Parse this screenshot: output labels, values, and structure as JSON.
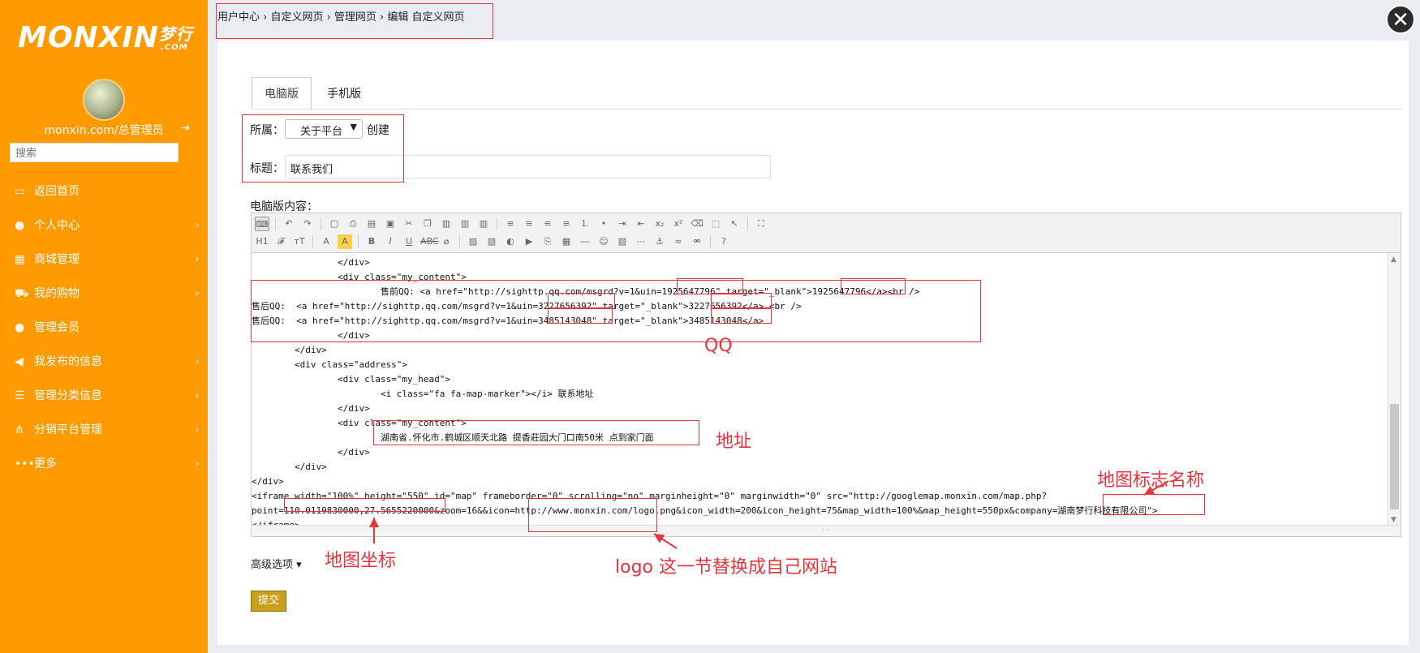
{
  "sidebar": {
    "logo": "MONXIN",
    "logo_cn": "梦行",
    "logo_com": ".COM",
    "user": "monxin.com/总管理员",
    "logout_icon": "logout-icon",
    "search_placeholder": "搜索",
    "items": [
      {
        "label": "返回首页",
        "icon": "monitor-icon"
      },
      {
        "label": "个人中心",
        "icon": "users-icon"
      },
      {
        "label": "商城管理",
        "icon": "store-icon"
      },
      {
        "label": "我的购物",
        "icon": "cart-icon"
      },
      {
        "label": "管理会员",
        "icon": "user-icon"
      },
      {
        "label": "我发布的信息",
        "icon": "megaphone-icon"
      },
      {
        "label": "管理分类信息",
        "icon": "list-icon"
      },
      {
        "label": "分销平台管理",
        "icon": "sitemap-icon"
      },
      {
        "label": "更多",
        "icon": "more-icon"
      }
    ]
  },
  "breadcrumb": "用户中心 › 自定义网页 › 管理网页 › 编辑 自定义网页",
  "close_label": "✕",
  "tabs": [
    "电脑版",
    "手机版"
  ],
  "form": {
    "belong_label": "所属：",
    "belong_value": "关于平台",
    "create_link": "创建",
    "title_label": "标题：",
    "title_value": "联系我们",
    "content_label": "电脑版内容："
  },
  "code_lines": [
    "                </div>",
    "                <div class=\"my_content\">",
    "                        售前QQ: <a href=\"http://sighttp.qq.com/msgrd?v=1&uin=1925647796\" target=\"_blank\">1925647796</a><br />",
    "售后QQ:  <a href=\"http://sighttp.qq.com/msgrd?v=1&uin=3227656392\" target=\"_blank\">3227656392</a> <br />",
    "售后QQ:  <a href=\"http://sighttp.qq.com/msgrd?v=1&uin=3485143048\" target=\"_blank\">3485143048</a>",
    "                </div>",
    "        </div>",
    "        <div class=\"address\">",
    "                <div class=\"my_head\">",
    "                        <i class=\"fa fa-map-marker\"></i> 联系地址",
    "                </div>",
    "                <div class=\"my_content\">",
    "                        湖南省.怀化市.鹤城区顺天北路 提香莊园大门口南50米 点到家门面",
    "                </div>",
    "        </div>",
    "</div>",
    "<iframe width=\"100%\" height=\"550\" id=\"map\" frameborder=\"0\" scrolling=\"no\" marginheight=\"0\" marginwidth=\"0\" src=\"http://googlemap.monxin.com/map.php?",
    "point=110.0119830000,27.5655220000&zoom=16&&icon=http://www.monxin.com/logo.png&icon_width=200&icon_height=75&map_width=100%&map_height=550px&company=湖南梦行科技有限公司\">",
    "</iframe>"
  ],
  "annotations": {
    "qq": "QQ",
    "address": "地址",
    "map_name": "地图标志名称",
    "map_coord": "地图坐标",
    "logo_note": "logo 这一节替换成自己网站"
  },
  "advanced_label": "高级选项 ▾",
  "submit_label": "提交",
  "colors": {
    "sidebar": "#ff9a00",
    "annotation": "#e8333a",
    "submit": "#c9a01c"
  }
}
